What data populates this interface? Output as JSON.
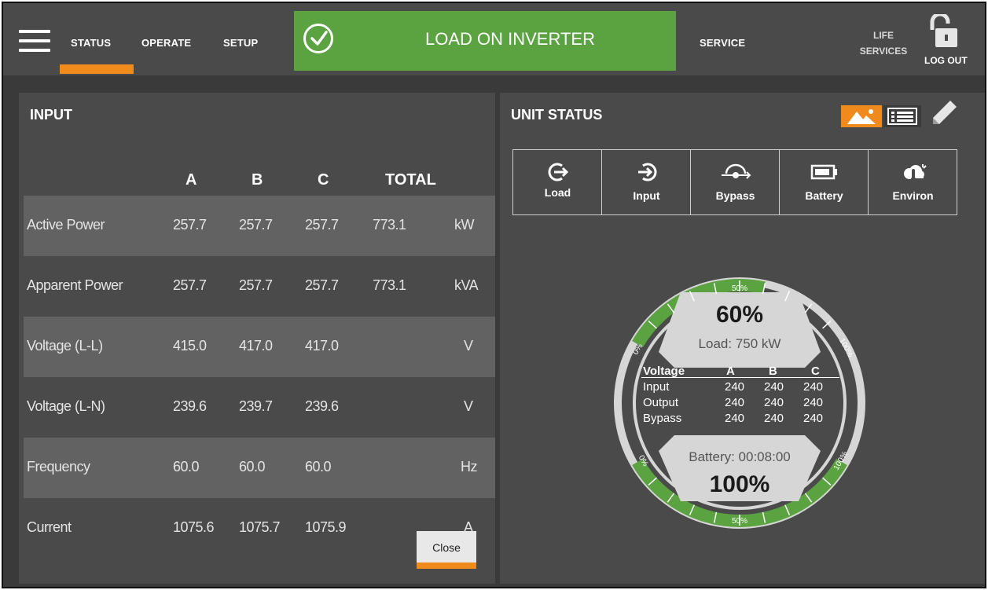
{
  "nav": {
    "items": [
      "STATUS",
      "OPERATE",
      "SETUP"
    ],
    "active": "STATUS",
    "service": "SERVICE",
    "life_services_line1": "LIFE",
    "life_services_line2": "SERVICES",
    "logout": "LOG OUT"
  },
  "banner": {
    "text": "LOAD ON INVERTER",
    "color": "#5aa340"
  },
  "input": {
    "title": "INPUT",
    "columns": [
      "A",
      "B",
      "C",
      "TOTAL"
    ],
    "rows": [
      {
        "label": "Active Power",
        "a": "257.7",
        "b": "257.7",
        "c": "257.7",
        "total": "773.1",
        "unit": "kW"
      },
      {
        "label": "Apparent Power",
        "a": "257.7",
        "b": "257.7",
        "c": "257.7",
        "total": "773.1",
        "unit": "kVA"
      },
      {
        "label": "Voltage (L-L)",
        "a": "415.0",
        "b": "417.0",
        "c": "417.0",
        "total": "",
        "unit": "V"
      },
      {
        "label": "Voltage (L-N)",
        "a": "239.6",
        "b": "239.7",
        "c": "239.6",
        "total": "",
        "unit": "V"
      },
      {
        "label": "Frequency",
        "a": "60.0",
        "b": "60.0",
        "c": "60.0",
        "total": "",
        "unit": "Hz"
      },
      {
        "label": "Current",
        "a": "1075.6",
        "b": "1075.7",
        "c": "1075.9",
        "total": "",
        "unit": "A"
      }
    ],
    "close_label": "Close"
  },
  "unit_status": {
    "title": "UNIT STATUS",
    "tabs": [
      "Load",
      "Input",
      "Bypass",
      "Battery",
      "Environ"
    ],
    "gauge": {
      "load_percent": "60%",
      "load_fraction": 0.6,
      "load_label": "Load: 750 kW",
      "battery_label": "Battery: 00:08:00",
      "battery_percent": "100%",
      "battery_fraction": 1.0,
      "ring_labels": {
        "top_mid": "50%",
        "top_left": "0%",
        "top_right": "100%",
        "bot_left": "0%",
        "bot_right": "100%",
        "bot_mid": "50%"
      },
      "voltage_header": [
        "Voltage",
        "A",
        "B",
        "C"
      ],
      "voltage_rows": [
        {
          "label": "Input",
          "a": "240",
          "b": "240",
          "c": "240"
        },
        {
          "label": "Output",
          "a": "240",
          "b": "240",
          "c": "240"
        },
        {
          "label": "Bypass",
          "a": "240",
          "b": "240",
          "c": "240"
        }
      ]
    }
  },
  "colors": {
    "accent": "#f08a1c",
    "ok_green": "#5aa340",
    "panel": "#4a4a4a",
    "background": "#3a3a3a"
  },
  "icons": [
    "menu-icon",
    "check-circle-icon",
    "lock-open-icon",
    "graphic-view-icon",
    "list-view-icon",
    "pencil-icon",
    "load-icon",
    "input-icon",
    "bypass-icon",
    "battery-icon",
    "environment-icon"
  ]
}
